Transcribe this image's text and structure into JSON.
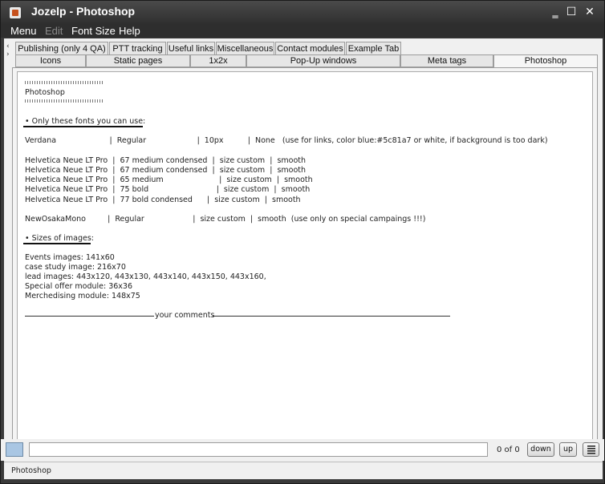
{
  "window": {
    "title": "Jozelp - Photoshop",
    "minimize": "‗",
    "maximize": "☐",
    "close": "✕"
  },
  "menu": {
    "items": [
      "Menu",
      "Edit",
      "Font Size",
      "Help"
    ]
  },
  "tabs_row1": [
    "Publishing (only 4 QA)",
    "PTT tracking",
    "Useful links",
    "Miscellaneous",
    "Contact modules",
    "Example Tab"
  ],
  "tabs_row2": [
    "Icons",
    "Static pages",
    "1x2x",
    "Pop-Up windows",
    "Meta tags",
    "Photoshop"
  ],
  "active_tab": "Photoshop",
  "content": {
    "heading": "Photoshop",
    "fonts_title": "• Only these fonts you can use:",
    "fonts_lines": [
      "Verdana                      |  Regular                     |  10px          |  None   (use for links, color blue:#5c81a7 or white, if background is too dark)",
      "Helvetica Neue LT Pro  |  67 medium condensed  |  size custom  |  smooth",
      "Helvetica Neue LT Pro  |  67 medium condensed  |  size custom  |  smooth",
      "Helvetica Neue LT Pro  |  65 medium                       |  size custom  |  smooth",
      "Helvetica Neue LT Pro  |  75 bold                            |  size custom  |  smooth",
      "Helvetica Neue LT Pro  |  77 bold condensed      |  size custom  |  smooth"
    ],
    "mono_line": "NewOsakaMono         |  Regular                    |  size custom  |  smooth  (use only on special campaings !!!)",
    "images_title": "• Sizes of images:",
    "images_lines": [
      "Events images: 141x60",
      "case study image: 216x70",
      "lead images: 443x120, 443x130, 443x140, 443x150, 443x160,",
      "Special offer module: 36x36",
      "Merchedising module: 148x75"
    ],
    "comments_label": "your comments"
  },
  "findbar": {
    "count": "0 of 0",
    "down": "down",
    "up": "up"
  },
  "status": {
    "text": "Photoshop"
  }
}
